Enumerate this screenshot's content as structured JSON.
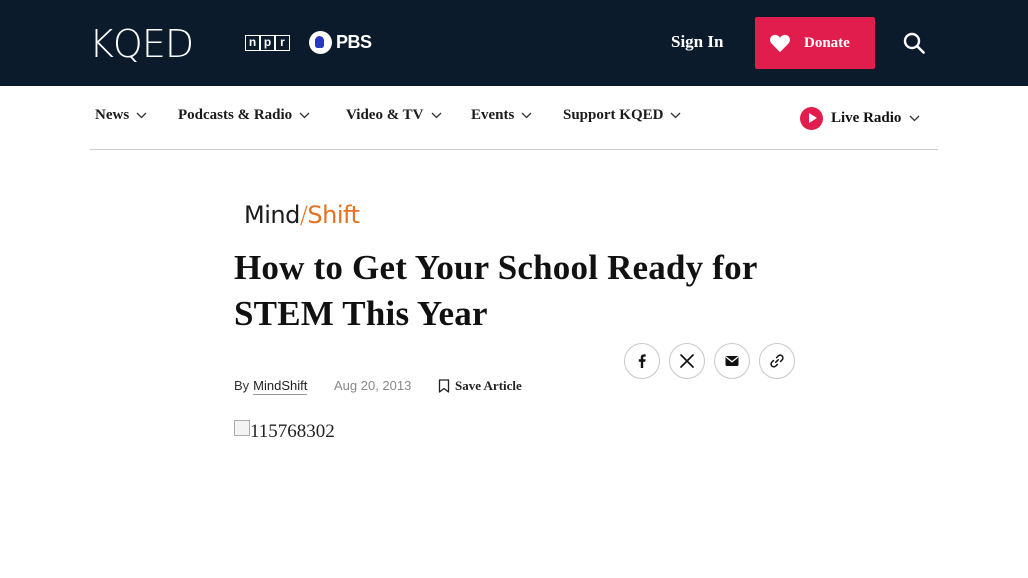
{
  "header": {
    "logo_text": "KQED",
    "npr_letters": [
      "n",
      "p",
      "r"
    ],
    "pbs_text": "PBS",
    "signin_label": "Sign In",
    "donate_label": "Donate",
    "search_icon": "search-icon"
  },
  "nav": {
    "items": [
      {
        "label": "News"
      },
      {
        "label": "Podcasts & Radio"
      },
      {
        "label": "Video & TV"
      },
      {
        "label": "Events"
      },
      {
        "label": "Support KQED"
      }
    ],
    "live_label": "Live Radio"
  },
  "article": {
    "brand": {
      "mind": "Mind",
      "slash": "/",
      "shift": "Shift"
    },
    "title": "How to Get Your School Ready for STEM This Year",
    "by_prefix": "By",
    "author": "MindShift",
    "date": "Aug 20, 2013",
    "save_label": "Save Article",
    "share_icons": [
      "facebook-icon",
      "x-icon",
      "email-icon",
      "link-icon"
    ],
    "image_alt": "115768302"
  },
  "colors": {
    "topbar": "#0c1b2b",
    "accent": "#e01d4c",
    "brand_orange": "#e37222"
  }
}
